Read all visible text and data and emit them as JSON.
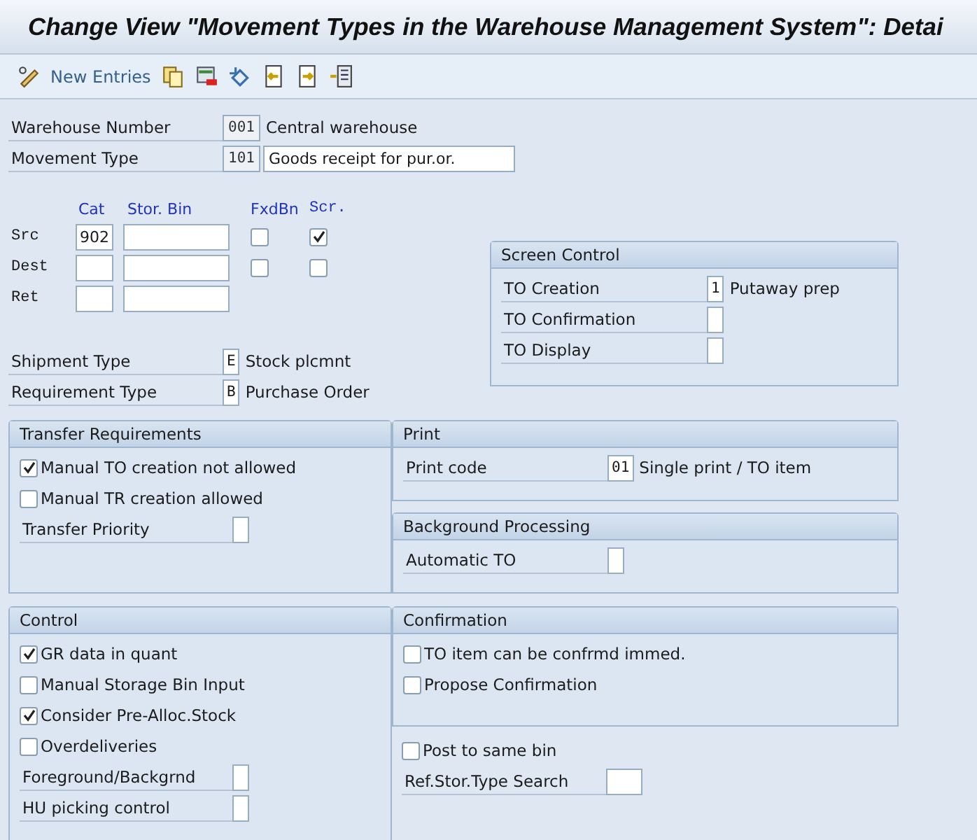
{
  "title": "Change View \"Movement Types in the Warehouse Management System\": Detai",
  "toolbar": {
    "new_entries": "New Entries"
  },
  "header_fields": [
    {
      "label": "Warehouse Number",
      "value": "001",
      "text": "Central warehouse"
    },
    {
      "label": "Movement Type",
      "value": "101",
      "description": "Goods receipt for pur.or."
    }
  ],
  "bin_grid": {
    "columns": [
      "Cat",
      "Stor. Bin",
      "FxdBn",
      "Scr."
    ],
    "rows": [
      {
        "label": "Src",
        "cat": "902",
        "fixed_bin": false,
        "screen": true
      },
      {
        "label": "Dest",
        "fixed_bin": false,
        "screen": false
      },
      {
        "label": "Ret"
      }
    ]
  },
  "type_fields": [
    {
      "label": "Shipment Type",
      "value": "E",
      "text": "Stock plcmnt"
    },
    {
      "label": "Requirement Type",
      "value": "B",
      "text": "Purchase Order"
    }
  ],
  "screen_control": {
    "title": "Screen Control",
    "fields": [
      {
        "label": "TO Creation",
        "value": "1",
        "text": "Putaway prep"
      },
      {
        "label": "TO Confirmation"
      },
      {
        "label": "TO Display"
      }
    ]
  },
  "transfer_requirements": {
    "title": "Transfer Requirements",
    "items": [
      {
        "kind": "checkbox",
        "label": "Manual TO creation not allowed",
        "checked": true
      },
      {
        "kind": "checkbox",
        "label": "Manual TR creation allowed",
        "checked": false
      },
      {
        "kind": "field",
        "label": "Transfer Priority"
      }
    ]
  },
  "print": {
    "title": "Print",
    "items": [
      {
        "kind": "field",
        "label": "Print code",
        "value": "01",
        "text": "Single print / TO item"
      }
    ]
  },
  "background_processing": {
    "title": "Background Processing",
    "items": [
      {
        "kind": "field",
        "label": "Automatic TO"
      }
    ]
  },
  "control": {
    "title": "Control",
    "items": [
      {
        "kind": "checkbox",
        "label": "GR data in quant",
        "checked": true
      },
      {
        "kind": "checkbox",
        "label": "Manual Storage Bin Input",
        "checked": false
      },
      {
        "kind": "checkbox",
        "label": "Consider Pre-Alloc.Stock",
        "checked": true
      },
      {
        "kind": "checkbox",
        "label": "Overdeliveries",
        "checked": false
      },
      {
        "kind": "field",
        "label": "Foreground/Backgrnd"
      },
      {
        "kind": "field",
        "label": "HU picking control"
      }
    ]
  },
  "confirmation": {
    "title": "Confirmation",
    "items": [
      {
        "kind": "checkbox",
        "label": "TO item can be confrmd immed.",
        "checked": false
      },
      {
        "kind": "checkbox",
        "label": "Propose Confirmation",
        "checked": false
      }
    ]
  },
  "other_items": [
    {
      "kind": "checkbox",
      "label": "Post to same bin",
      "checked": false
    },
    {
      "kind": "wide_field",
      "label": "Ref.Stor.Type Search"
    }
  ]
}
